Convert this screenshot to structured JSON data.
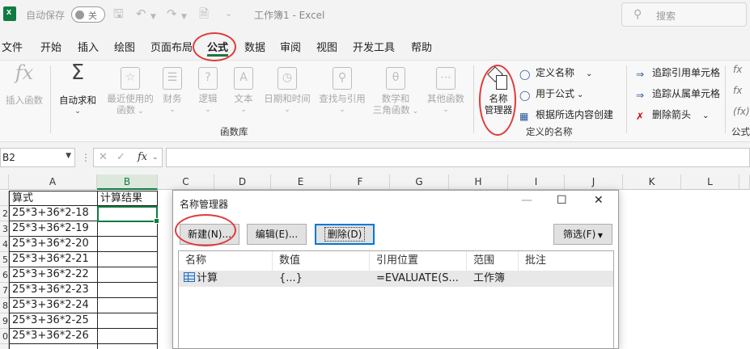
{
  "titlebar": {
    "autosave_label": "自动保存",
    "autosave_state": "关",
    "document_title": "工作簿1  -  Excel",
    "search_placeholder": "搜索"
  },
  "menu": {
    "items": [
      "文件",
      "开始",
      "插入",
      "绘图",
      "页面布局",
      "公式",
      "数据",
      "审阅",
      "视图",
      "开发工具",
      "帮助"
    ],
    "active": "公式"
  },
  "ribbon": {
    "insert_function": "插入函数",
    "autosum": "自动求和",
    "recent_1": "最近使用的",
    "recent_2": "函数",
    "finance": "财务",
    "logic": "逻辑",
    "text": "文本",
    "datetime": "日期和时间",
    "lookup": "查找与引用",
    "math_1": "数学和",
    "math_2": "三角函数",
    "other": "其他函数",
    "library_group": "函数库",
    "name_manager_1": "名称",
    "name_manager_2": "管理器",
    "define_name": "定义名称",
    "use_in_formula": "用于公式",
    "create_from_selection": "根据所选内容创建",
    "defined_names_group": "定义的名称",
    "trace_precedents": "追踪引用单元格",
    "trace_dependents": "追踪从属单元格",
    "remove_arrows": "删除箭头",
    "formula_audit_partial": "公式"
  },
  "formula_bar": {
    "name_box": "B2",
    "fx": "fx",
    "content": ""
  },
  "grid": {
    "columns": [
      "A",
      "B",
      "C",
      "D",
      "E",
      "F",
      "G",
      "H",
      "I",
      "J",
      "K",
      "L"
    ],
    "row_numbers": [
      "",
      "2",
      "3",
      "4",
      "5",
      "6",
      "7",
      "8",
      "9",
      "0"
    ],
    "header_a": "算式",
    "header_b": "计算结果",
    "formulas": [
      "25*3+36*2-18",
      "25*3+36*2-19",
      "25*3+36*2-20",
      "25*3+36*2-21",
      "25*3+36*2-22",
      "25*3+36*2-23",
      "25*3+36*2-24",
      "25*3+36*2-25",
      "25*3+36*2-26"
    ]
  },
  "dialog": {
    "title": "名称管理器",
    "btn_new": "新建(N)...",
    "btn_edit": "编辑(E)...",
    "btn_delete": "删除(D)",
    "btn_filter": "筛选(F)",
    "columns": [
      "名称",
      "数值",
      "引用位置",
      "范围",
      "批注"
    ],
    "row": {
      "name": "计算",
      "value": "{...}",
      "refers_to": "=EVALUATE(S...",
      "scope": "工作簿",
      "comment": ""
    }
  },
  "colors": {
    "excel_green": "#107c41",
    "highlight_red": "#e03a3a",
    "focus_blue": "#0078d7"
  }
}
